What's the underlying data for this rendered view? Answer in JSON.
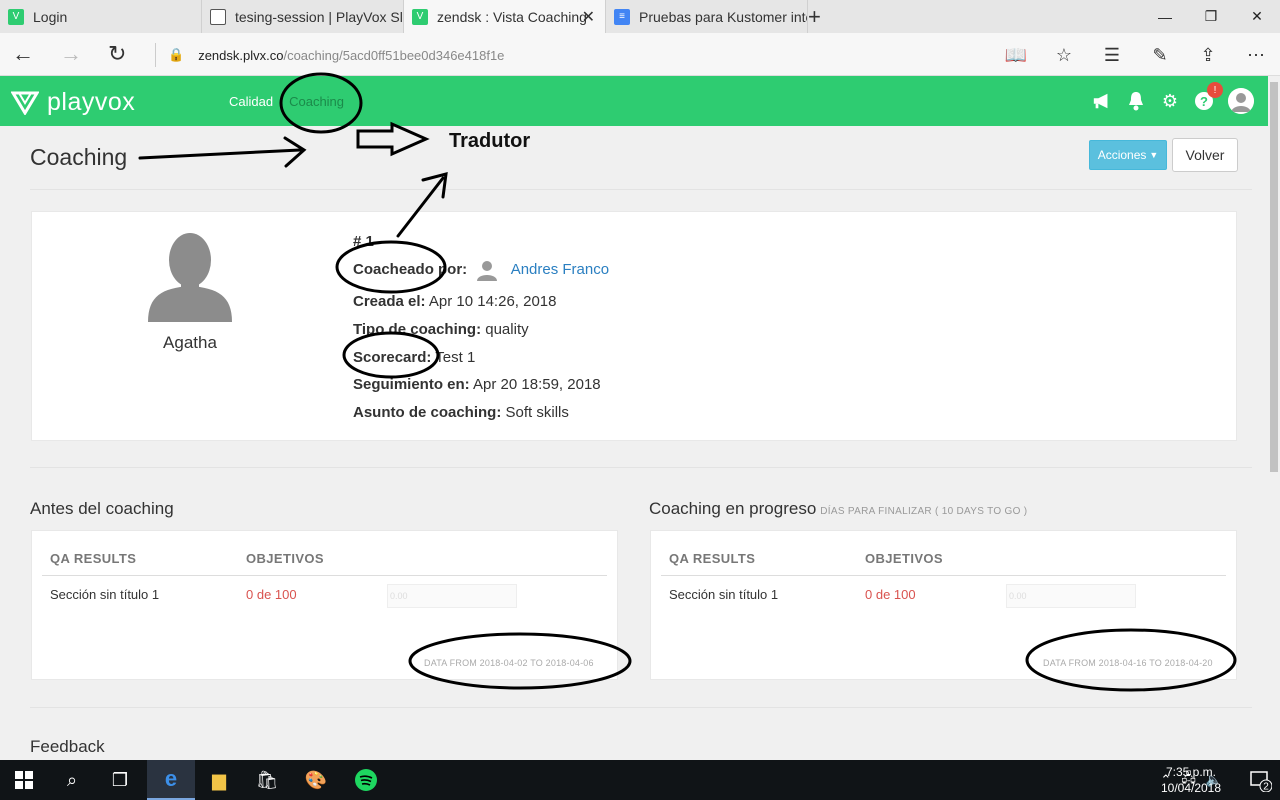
{
  "browser": {
    "tabs": [
      {
        "title": "Login",
        "icon": "playvox-favicon"
      },
      {
        "title": "tesing-session | PlayVox Sla",
        "icon": "page-favicon"
      },
      {
        "title": "zendsk : Vista Coaching",
        "icon": "playvox-favicon",
        "active": true
      },
      {
        "title": "Pruebas para Kustomer inte",
        "icon": "docs-favicon"
      }
    ],
    "url_host": "zendsk.plvx.co",
    "url_path": "/coaching/5acd0ff51bee0d346e418f1e"
  },
  "app": {
    "logo_text": "playvox",
    "nav": [
      {
        "label": "Calidad"
      },
      {
        "label": "Coaching",
        "active": true
      }
    ],
    "notification_badge": "!",
    "brand_color": "#2ecc71"
  },
  "page": {
    "title": "Coaching",
    "actions_button": "Acciones",
    "back_button": "Volver"
  },
  "coaching": {
    "agent_name": "Agatha",
    "number": "# 1",
    "coached_by_label": "Coacheado por:",
    "coached_by_value": "Andres Franco",
    "created_label": "Creada el:",
    "created_value": "Apr 10 14:26, 2018",
    "type_label": "Tipo de coaching:",
    "type_value": "quality",
    "scorecard_label": "Scorecard:",
    "scorecard_value": "Test 1",
    "followup_label": "Seguimiento en:",
    "followup_value": "Apr 20 18:59, 2018",
    "subject_label": "Asunto de coaching:",
    "subject_value": "Soft skills"
  },
  "before": {
    "title": "Antes del coaching",
    "col1": "QA RESULTS",
    "col2": "OBJETIVOS",
    "row_label": "Sección sin título 1",
    "row_value": "0 de 100",
    "progress_text": "0.00",
    "progress": 0,
    "data_from": "DATA FROM 2018-04-02 TO 2018-04-06"
  },
  "progress": {
    "title": "Coaching en progreso",
    "subtitle": "DÍAS PARA FINALIZAR ( 10 DAYS TO GO )",
    "col1": "QA RESULTS",
    "col2": "OBJETIVOS",
    "row_label": "Sección sin título 1",
    "row_value": "0 de 100",
    "progress_text": "0.00",
    "progress": 0,
    "data_from": "DATA FROM 2018-04-16 TO 2018-04-20"
  },
  "feedback_title": "Feedback",
  "annotation": {
    "label": "Tradutor"
  },
  "taskbar": {
    "time": "7:35 p.m.",
    "date": "10/04/2018",
    "notifications": "2"
  }
}
